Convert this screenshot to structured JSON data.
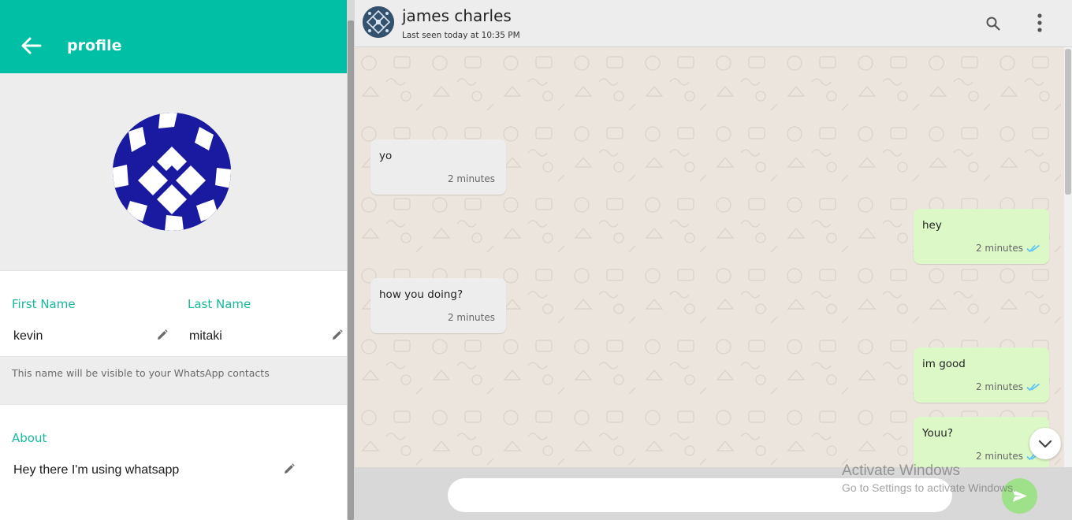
{
  "colors": {
    "accent": "#00bfa5",
    "label_green": "#17b89c",
    "incoming_bubble": "#ededed",
    "outgoing_bubble": "#dcf8c6",
    "chat_background": "#ece5dd",
    "read_ticks": "#4fc3f7",
    "send_button": "#9fe08a"
  },
  "profile_panel": {
    "back_icon": "arrow-left-icon",
    "title": "profile",
    "avatar_icon": "profile-picture",
    "first_name_label": "First Name",
    "first_name_value": "kevin",
    "last_name_label": "Last Name",
    "last_name_value": "mitaki",
    "edit_icon": "pencil-icon",
    "name_hint": "This name will be visible to your WhatsApp contacts",
    "about_label": "About",
    "about_value": "Hey there I'm using whatsapp"
  },
  "chat": {
    "contact_name": "james charles",
    "last_seen": "Last seen today at 10:35 PM",
    "header_icons": [
      "search-icon",
      "more-vert-icon"
    ],
    "messages": [
      {
        "direction": "incoming",
        "text": "yo",
        "time": "2 minutes",
        "read": false
      },
      {
        "direction": "outgoing",
        "text": "hey",
        "time": "2 minutes",
        "read": true
      },
      {
        "direction": "incoming",
        "text": "how you doing?",
        "time": "2 minutes",
        "read": false
      },
      {
        "direction": "outgoing",
        "text": "im good",
        "time": "2 minutes",
        "read": true
      },
      {
        "direction": "outgoing",
        "text": "Youu?",
        "time": "2 minutes",
        "read": true
      }
    ],
    "scroll_down_icon": "chevron-down-icon",
    "composer": {
      "placeholder": "",
      "send_icon": "send-icon"
    }
  },
  "watermark": {
    "title": "Activate Windows",
    "subtitle": "Go to Settings to activate Windows."
  }
}
